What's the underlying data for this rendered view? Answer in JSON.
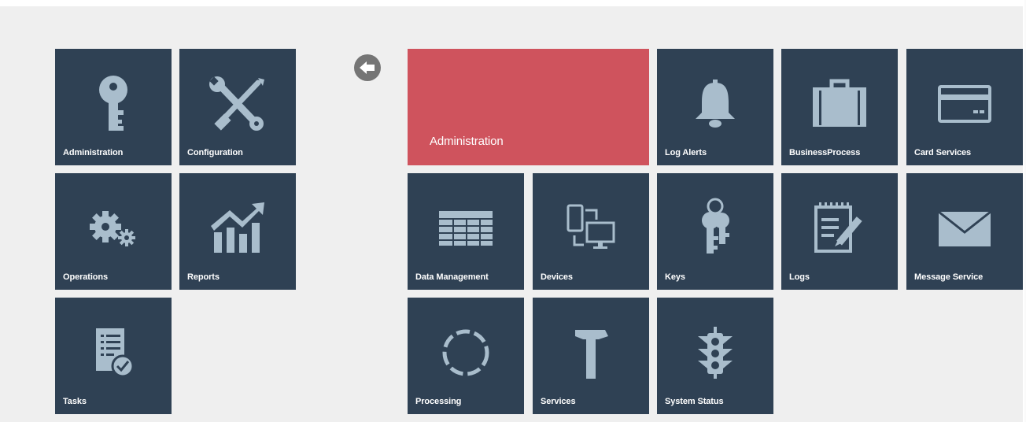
{
  "left_tiles": {
    "administration": {
      "label": "Administration",
      "icon": "key-icon"
    },
    "configuration": {
      "label": "Configuration",
      "icon": "wrench-screwdriver-icon"
    },
    "operations": {
      "label": "Operations",
      "icon": "gears-icon"
    },
    "reports": {
      "label": "Reports",
      "icon": "bar-chart-trend-icon"
    },
    "tasks": {
      "label": "Tasks",
      "icon": "task-checklist-icon"
    }
  },
  "back_button": {
    "icon": "back-arrow-icon"
  },
  "right_tiles": {
    "administration_header": {
      "label": "Administration",
      "color": "#cf535d"
    },
    "log_alerts": {
      "label": "Log Alerts",
      "icon": "bell-icon"
    },
    "business_process": {
      "label": "BusinessProcess",
      "icon": "briefcase-icon"
    },
    "card_services": {
      "label": "Card Services",
      "icon": "credit-card-icon"
    },
    "data_management": {
      "label": "Data Management",
      "icon": "table-grid-icon"
    },
    "devices": {
      "label": "Devices",
      "icon": "devices-icon"
    },
    "keys": {
      "label": "Keys",
      "icon": "keyring-icon"
    },
    "logs": {
      "label": "Logs",
      "icon": "notepad-pencil-icon"
    },
    "message_service": {
      "label": "Message Service",
      "icon": "envelope-icon"
    },
    "processing": {
      "label": "Processing",
      "icon": "dashed-circle-icon"
    },
    "services": {
      "label": "Services",
      "icon": "hammer-icon"
    },
    "system_status": {
      "label": "System Status",
      "icon": "traffic-light-icon"
    }
  },
  "colors": {
    "tile": "#2f4154",
    "accent": "#cf535d",
    "icon": "#a9bdcc",
    "background": "#efefef"
  }
}
